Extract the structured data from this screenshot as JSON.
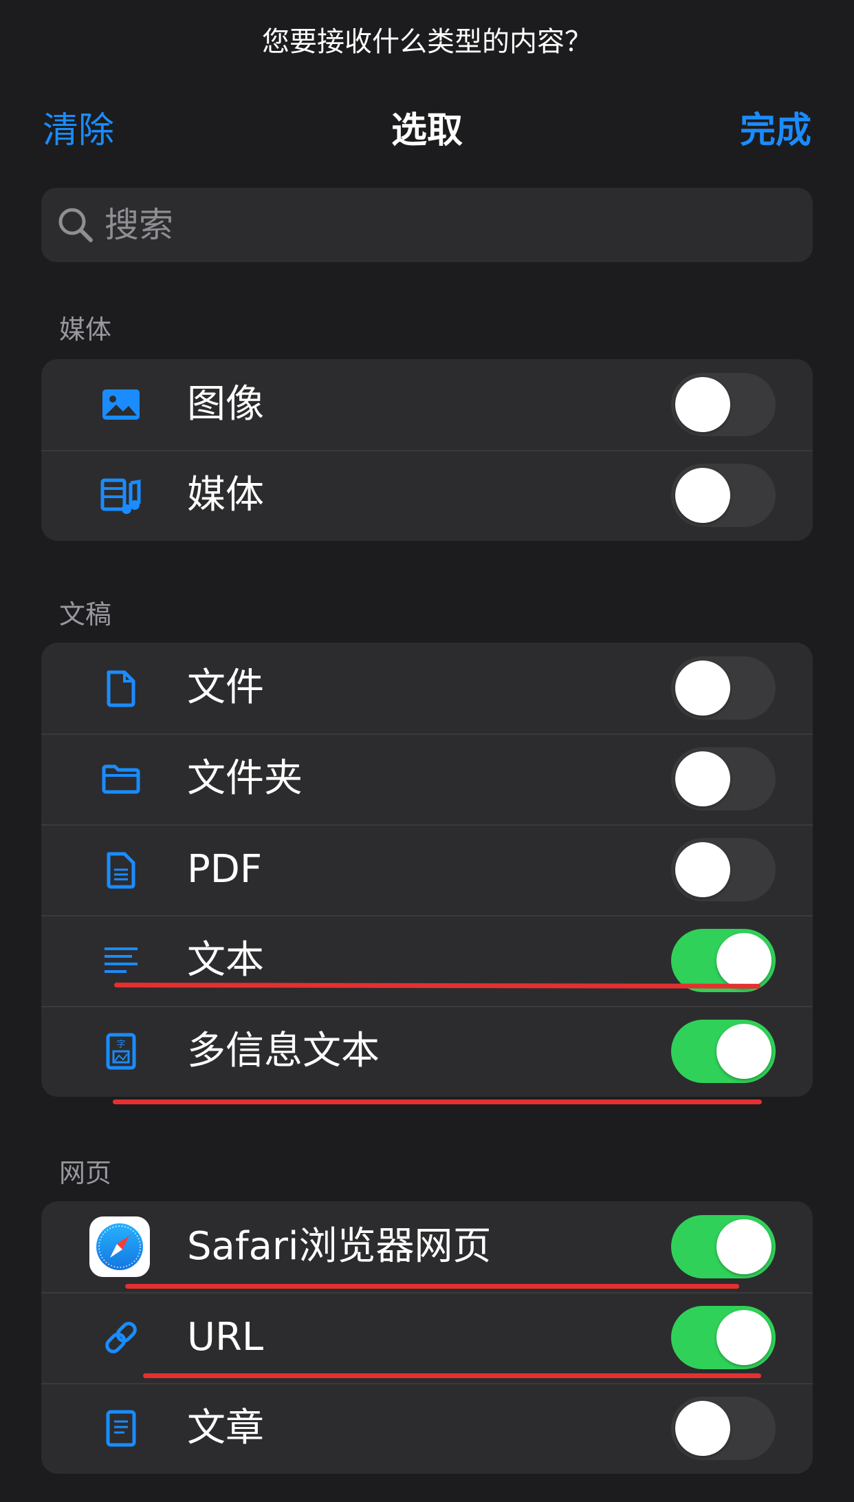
{
  "prompt": "您要接收什么类型的内容？",
  "nav": {
    "left": "清除",
    "title": "选取",
    "right": "完成"
  },
  "search": {
    "placeholder": "搜索"
  },
  "colors": {
    "accent": "#1a8cff",
    "toggle_on": "#30d158",
    "annotation": "#e53030"
  },
  "sections": [
    {
      "title": "媒体",
      "rows": [
        {
          "label": "图像",
          "icon": "photo-icon",
          "on": false
        },
        {
          "label": "媒体",
          "icon": "media-icon",
          "on": false
        }
      ]
    },
    {
      "title": "文稿",
      "rows": [
        {
          "label": "文件",
          "icon": "document-icon",
          "on": false
        },
        {
          "label": "文件夹",
          "icon": "folder-icon",
          "on": false
        },
        {
          "label": "PDF",
          "icon": "pdf-icon",
          "on": false
        },
        {
          "label": "文本",
          "icon": "text-lines-icon",
          "on": true
        },
        {
          "label": "多信息文本",
          "icon": "rich-text-icon",
          "on": true
        }
      ]
    },
    {
      "title": "网页",
      "rows": [
        {
          "label": "Safari浏览器网页",
          "icon": "safari-icon",
          "on": true
        },
        {
          "label": "URL",
          "icon": "link-icon",
          "on": true
        },
        {
          "label": "文章",
          "icon": "article-icon",
          "on": false
        }
      ]
    }
  ]
}
